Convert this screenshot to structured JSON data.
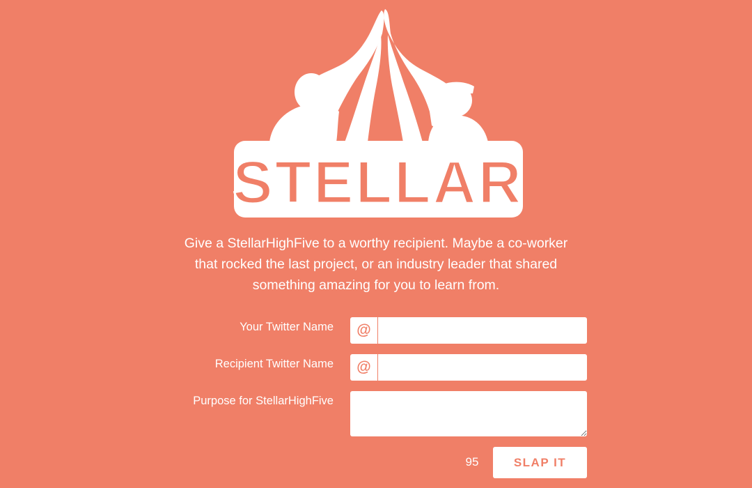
{
  "brand": {
    "wordmark": "STELLAR",
    "icon": "high-five-silhouette-icon",
    "background_color": "#f07f67",
    "foreground_color": "#ffffff"
  },
  "intro": {
    "text": "Give a StellarHighFive to a worthy recipient. Maybe a co-worker that rocked the last project, or an industry leader that shared something amazing for you to learn from."
  },
  "form": {
    "your_twitter": {
      "label": "Your Twitter Name",
      "prefix": "@",
      "value": ""
    },
    "recipient_twitter": {
      "label": "Recipient Twitter Name",
      "prefix": "@",
      "value": ""
    },
    "purpose": {
      "label": "Purpose for StellarHighFive",
      "value": ""
    },
    "char_counter": "95",
    "submit_label": "SLAP IT"
  }
}
